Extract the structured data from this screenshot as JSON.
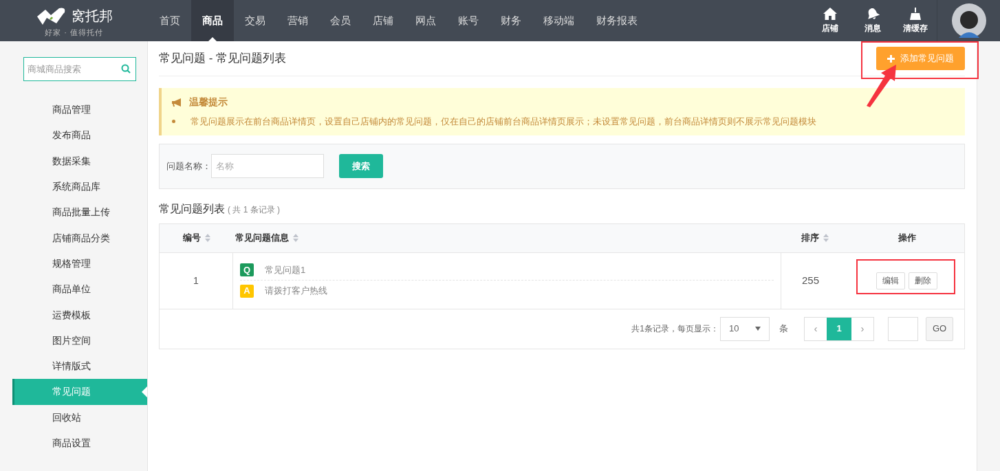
{
  "logo": {
    "name": "窝托邦",
    "slogan": "好家 · 值得托付"
  },
  "nav": [
    {
      "label": "首页",
      "selected": false
    },
    {
      "label": "商品",
      "selected": true
    },
    {
      "label": "交易",
      "selected": false
    },
    {
      "label": "营销",
      "selected": false
    },
    {
      "label": "会员",
      "selected": false
    },
    {
      "label": "店铺",
      "selected": false
    },
    {
      "label": "网点",
      "selected": false
    },
    {
      "label": "账号",
      "selected": false
    },
    {
      "label": "财务",
      "selected": false
    },
    {
      "label": "移动端",
      "selected": false
    },
    {
      "label": "财务报表",
      "selected": false
    }
  ],
  "tools": [
    {
      "kind": "store",
      "label": "店铺"
    },
    {
      "kind": "bell",
      "label": "消息"
    },
    {
      "kind": "broom",
      "label": "清缓存"
    }
  ],
  "sidebar": {
    "search_placeholder": "商城商品搜索",
    "items": [
      {
        "label": "商品管理",
        "selected": false
      },
      {
        "label": "发布商品",
        "selected": false
      },
      {
        "label": "数据采集",
        "selected": false
      },
      {
        "label": "系统商品库",
        "selected": false
      },
      {
        "label": "商品批量上传",
        "selected": false
      },
      {
        "label": "店铺商品分类",
        "selected": false
      },
      {
        "label": "规格管理",
        "selected": false
      },
      {
        "label": "商品单位",
        "selected": false
      },
      {
        "label": "运费模板",
        "selected": false
      },
      {
        "label": "图片空间",
        "selected": false
      },
      {
        "label": "详情版式",
        "selected": false
      },
      {
        "label": "常见问题",
        "selected": true
      },
      {
        "label": "回收站",
        "selected": false
      },
      {
        "label": "商品设置",
        "selected": false
      }
    ]
  },
  "page_title": "常见问题 - 常见问题列表",
  "add_button": "添加常见问题",
  "notice": {
    "title": "温馨提示",
    "items": [
      "常见问题展示在前台商品详情页，设置自己店铺内的常见问题，仅在自己的店铺前台商品详情页展示；未设置常见问题，前台商品详情页则不展示常见问题模块"
    ]
  },
  "filter": {
    "label": "问题名称：",
    "placeholder": "名称",
    "button": "搜索"
  },
  "list": {
    "title": "常见问题列表",
    "count": "( 共 1 条记录 )"
  },
  "table": {
    "columns": [
      {
        "label": "编号",
        "sortable": true
      },
      {
        "label": "常见问题信息",
        "sortable": true
      },
      {
        "label": "排序",
        "sortable": true
      },
      {
        "label": "操作",
        "sortable": false
      }
    ],
    "rows": [
      {
        "id": "1",
        "q_badge": "Q",
        "question": "常见问题1",
        "a_badge": "A",
        "answer": "请拨打客户热线",
        "sort": "255",
        "actions": [
          "编辑",
          "删除"
        ]
      }
    ]
  },
  "pagination": {
    "summary": "共1条记录，每页显示：",
    "page_size": "10",
    "unit": "条",
    "prev": "‹",
    "next": "›",
    "pages": [
      {
        "label": "1",
        "selected": true
      }
    ],
    "go": "GO"
  }
}
